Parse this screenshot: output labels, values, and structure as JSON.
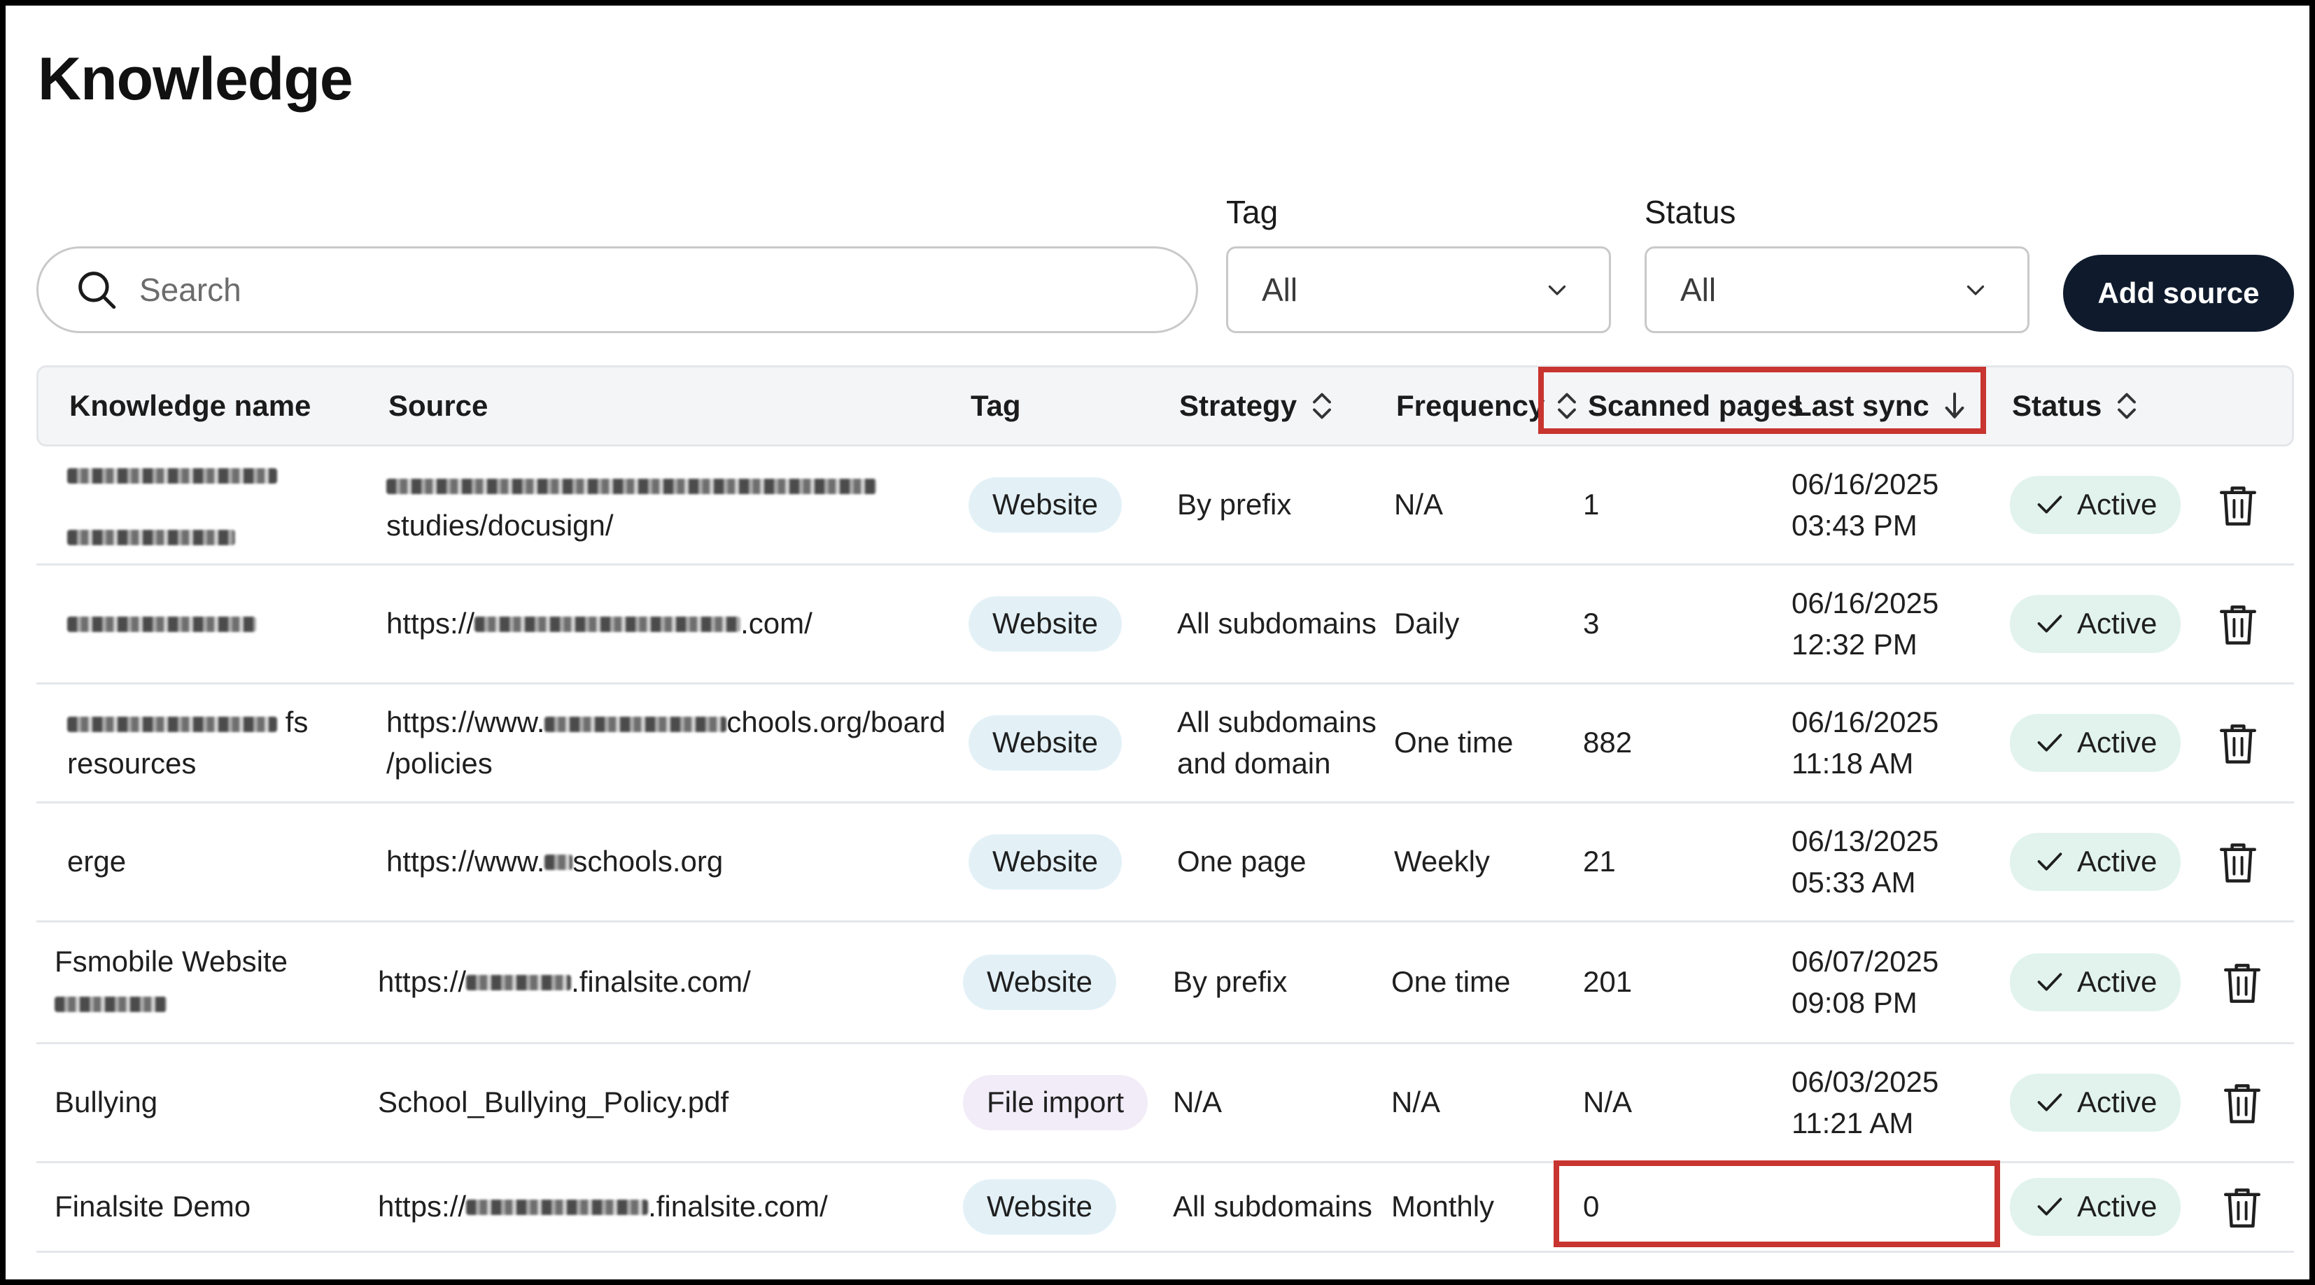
{
  "page": {
    "title": "Knowledge"
  },
  "filters": {
    "search_placeholder": "Search",
    "tag": {
      "label": "Tag",
      "value": "All"
    },
    "status": {
      "label": "Status",
      "value": "All"
    },
    "add_source_label": "Add source"
  },
  "table": {
    "columns": {
      "name": "Knowledge name",
      "source": "Source",
      "tag": "Tag",
      "strategy": "Strategy",
      "frequency": "Frequency",
      "scanned": "Scanned pages",
      "last_sync": "Last sync",
      "status": "Status"
    },
    "rows": [
      {
        "name_lines": [
          "",
          ""
        ],
        "source_lines": [
          "",
          "studies/docusign/"
        ],
        "tag": "Website",
        "strategy": "By prefix",
        "frequency": "N/A",
        "scanned": "1",
        "last_sync_date": "06/16/2025",
        "last_sync_time": "03:43 PM",
        "status": "Active"
      },
      {
        "name_lines": [
          ""
        ],
        "source_lines": [
          "https://",
          ".com/"
        ],
        "tag": "Website",
        "strategy": "All subdomains",
        "frequency": "Daily",
        "scanned": "3",
        "last_sync_date": "06/16/2025",
        "last_sync_time": "12:32 PM",
        "status": "Active"
      },
      {
        "name_lines": [
          "fs",
          "resources"
        ],
        "source_lines": [
          "https://www.",
          "chools.org/board",
          "/policies"
        ],
        "tag": "Website",
        "strategy": "All subdomains\nand domain",
        "frequency": "One time",
        "scanned": "882",
        "last_sync_date": "06/16/2025",
        "last_sync_time": "11:18 AM",
        "status": "Active"
      },
      {
        "name_lines": [
          "erge"
        ],
        "source_lines": [
          "https://www.",
          "schools.org"
        ],
        "tag": "Website",
        "strategy": "One page",
        "frequency": "Weekly",
        "scanned": "21",
        "last_sync_date": "06/13/2025",
        "last_sync_time": "05:33 AM",
        "status": "Active"
      },
      {
        "name_lines": [
          "Fsmobile Website",
          ""
        ],
        "source_lines": [
          "https://",
          ".finalsite.com/"
        ],
        "tag": "Website",
        "strategy": "By prefix",
        "frequency": "One time",
        "scanned": "201",
        "last_sync_date": "06/07/2025",
        "last_sync_time": "09:08 PM",
        "status": "Active"
      },
      {
        "name_lines": [
          "Bullying"
        ],
        "source_lines": [
          "School_Bullying_Policy.pdf"
        ],
        "tag": "File import",
        "strategy": "N/A",
        "frequency": "N/A",
        "scanned": "N/A",
        "last_sync_date": "06/03/2025",
        "last_sync_time": "11:21 AM",
        "status": "Active"
      },
      {
        "name_lines": [
          "Finalsite Demo"
        ],
        "source_lines": [
          "https://",
          ".finalsite.com/"
        ],
        "tag": "Website",
        "strategy": "All subdomains",
        "frequency": "Monthly",
        "scanned": "0",
        "last_sync_date": "",
        "last_sync_time": "",
        "status": "Active"
      }
    ]
  },
  "colors": {
    "accent_dark": "#0f1b2d",
    "highlight_red": "#c8342f",
    "website_pill": "#e3f1f7",
    "file_pill": "#f1ecf7",
    "active_pill": "#e2f3ee"
  }
}
